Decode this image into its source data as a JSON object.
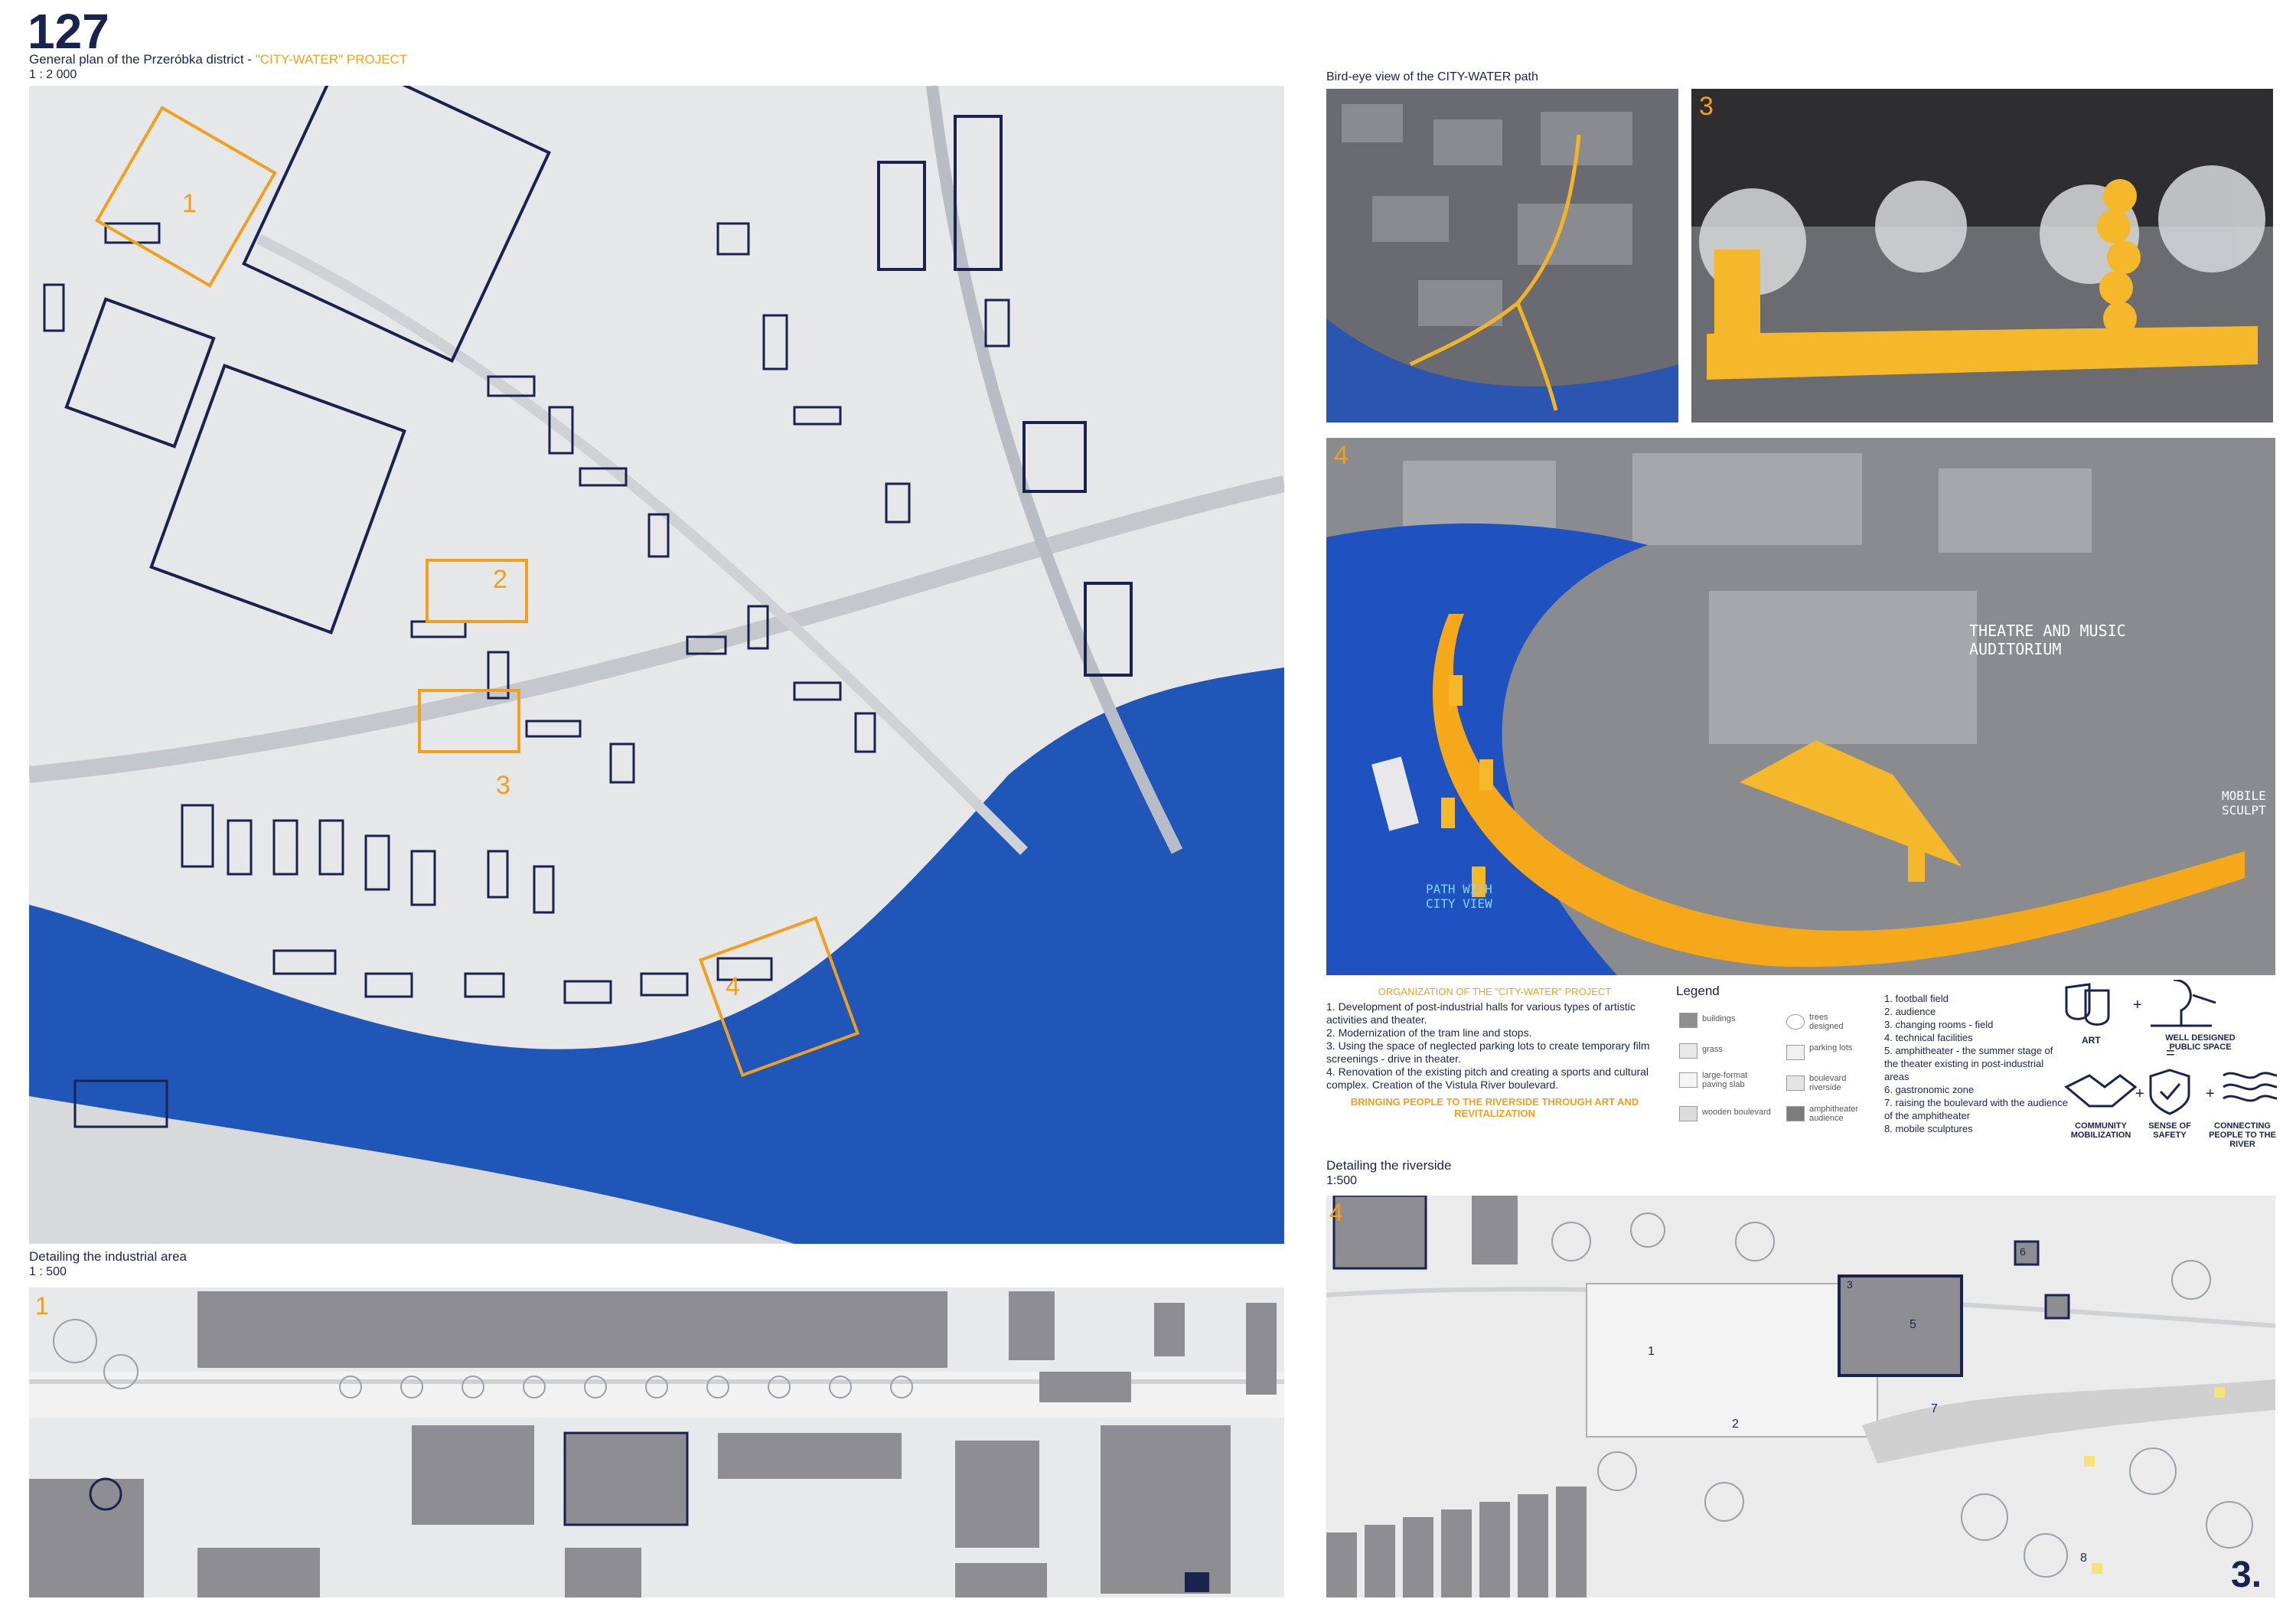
{
  "sheet": {
    "number": "127",
    "page_number": "3."
  },
  "general_plan": {
    "title_prefix": "General plan of the Przeróbka district - ",
    "title_highlight": "\"CITY-WATER\" PROJECT",
    "scale": "1 : 2 000",
    "zone_labels": [
      "1",
      "2",
      "3",
      "4"
    ]
  },
  "birdseye": {
    "title": "Bird-eye view of the CITY-WATER path"
  },
  "render3": {
    "label": "3"
  },
  "render4": {
    "label": "4",
    "annotation_theatre": "THEATRE AND MUSIC AUDITORIUM",
    "annotation_path": "PATH WITH CITY VIEW",
    "annotation_mobile": "MOBILE SCULPT"
  },
  "organization": {
    "heading": "ORGANIZATION OF THE \"CITY-WATER\" PROJECT",
    "items": [
      "1. Development of post-industrial halls for various types of artistic activities and theater.",
      "2. Modernization of the tram line and stops.",
      "3. Using the space of neglected parking lots to create temporary film screenings - drive in theater.",
      "4. Renovation of the existing pitch and creating a sports and cultural complex. Creation of the Vistula River boulevard."
    ],
    "tagline": "BRINGING PEOPLE TO THE RIVERSIDE THROUGH ART AND REVITALIZATION"
  },
  "legend": {
    "title": "Legend",
    "items": [
      {
        "label": "buildings"
      },
      {
        "label": "grass"
      },
      {
        "label": "large-format paving slab"
      },
      {
        "label": "wooden boulevard"
      },
      {
        "label": "trees designed"
      },
      {
        "label": "parking lots"
      },
      {
        "label": "boulevard riverside"
      },
      {
        "label": "amphitheater audience"
      }
    ]
  },
  "numbered_list": [
    "1. football field",
    "2. audience",
    "3. changing rooms - field",
    "4. technical facilities",
    "5. amphitheater - the summer stage of the theater existing in post-industrial areas",
    "6. gastronomic zone",
    "7. raising the boulevard with the audience of the amphitheater",
    "8. mobile sculptures"
  ],
  "diagram": {
    "art": "ART",
    "public_space": "WELL DESIGNED PUBLIC SPACE",
    "community": "COMMUNITY MOBILIZATION",
    "safety": "SENSE OF SAFETY",
    "river": "CONNECTING PEOPLE TO THE RIVER",
    "plus": "+",
    "equals": "="
  },
  "riverside_detail": {
    "title": "Detailing the riverside",
    "scale": "1:500",
    "label": "4",
    "numbers": [
      "1",
      "2",
      "3",
      "5",
      "6",
      "7",
      "8"
    ]
  },
  "industrial_detail": {
    "title": "Detailing the industrial area",
    "scale": "1 : 500",
    "label": "1"
  },
  "colors": {
    "navy": "#1a2350",
    "orange": "#f0a020",
    "river_blue": "#1f56b8",
    "yellow": "#f5b82a"
  }
}
